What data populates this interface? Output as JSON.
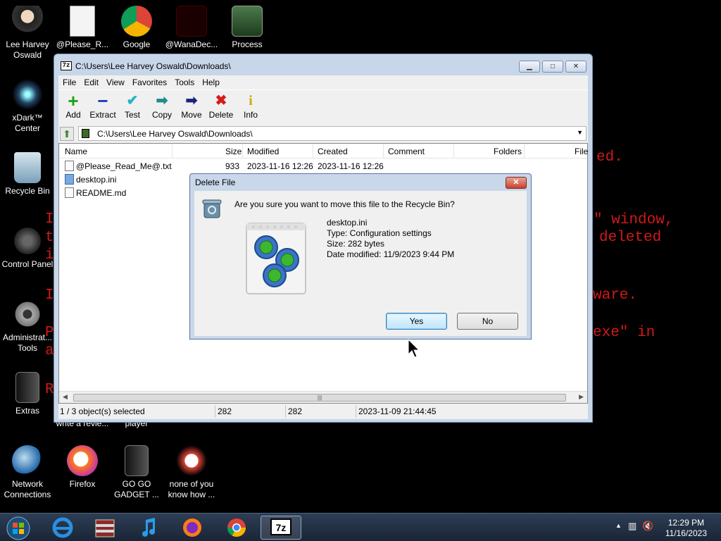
{
  "background_text": [
    {
      "text": "ed."
    },
    {
      "text": "\" window,"
    },
    {
      "text": "deleted"
    },
    {
      "text": "ware."
    },
    {
      "text": "exe\" in"
    },
    {
      "text": "I"
    },
    {
      "text": "t"
    },
    {
      "text": "i"
    },
    {
      "text": "I"
    },
    {
      "text": "P"
    },
    {
      "text": "a"
    },
    {
      "text": "R"
    }
  ],
  "desktop_icons": [
    {
      "label": "Lee Harvey Oswald"
    },
    {
      "label": "@Please_R..."
    },
    {
      "label": "Google"
    },
    {
      "label": "@WanaDec..."
    },
    {
      "label": "Process"
    },
    {
      "label": "xDark™ Center"
    },
    {
      "label": "Recycle Bin"
    },
    {
      "label": "Control Panel"
    },
    {
      "label": "Administrat... Tools"
    },
    {
      "label": "Extras"
    },
    {
      "label": "Network Connections"
    },
    {
      "label": "Firefox"
    },
    {
      "label": "GO GO GADGET ..."
    },
    {
      "label": "none of you know how ..."
    },
    {
      "label": "write a revie..."
    },
    {
      "label": "player"
    }
  ],
  "window": {
    "app_icon": "7z",
    "title": "C:\\Users\\Lee Harvey Oswald\\Downloads\\",
    "menu": [
      "File",
      "Edit",
      "View",
      "Favorites",
      "Tools",
      "Help"
    ],
    "toolbar": [
      {
        "label": "Add",
        "icon": "plus-icon",
        "color": "#1aa31a"
      },
      {
        "label": "Extract",
        "icon": "minus-icon",
        "color": "#1a3bb5"
      },
      {
        "label": "Test",
        "icon": "check-icon",
        "color": "#23b3c8"
      },
      {
        "label": "Copy",
        "icon": "copy-arrow-icon",
        "color": "#1f8a8a"
      },
      {
        "label": "Move",
        "icon": "move-arrow-icon",
        "color": "#16237a"
      },
      {
        "label": "Delete",
        "icon": "delete-x-icon",
        "color": "#d81a1a"
      },
      {
        "label": "Info",
        "icon": "info-icon",
        "color": "#d6a90a"
      }
    ],
    "address": "C:\\Users\\Lee Harvey Oswald\\Downloads\\",
    "columns": [
      "Name",
      "Size",
      "Modified",
      "Created",
      "Comment",
      "Folders",
      "File"
    ],
    "files": [
      {
        "name": "@Please_Read_Me@.txt",
        "size": "933",
        "modified": "2023-11-16 12:26",
        "created": "2023-11-16 12:26"
      },
      {
        "name": "desktop.ini",
        "size": "",
        "modified": "",
        "created": ""
      },
      {
        "name": "README.md",
        "size": "",
        "modified": "",
        "created": ""
      }
    ],
    "status": {
      "selected": "1 / 3 object(s) selected",
      "size1": "282",
      "size2": "282",
      "date": "2023-11-09 21:44:45"
    }
  },
  "dialog": {
    "title": "Delete File",
    "close": "✕",
    "question": "Are you sure you want to move this file to the Recycle Bin?",
    "file_name": "desktop.ini",
    "file_type": "Type: Configuration settings",
    "file_size": "Size: 282 bytes",
    "file_date": "Date modified: 11/9/2023 9:44 PM",
    "yes": "Yes",
    "no": "No"
  },
  "taskbar": {
    "time": "12:29 PM",
    "date": "11/16/2023",
    "apps": [
      "start-orb",
      "internet-explorer",
      "archive-manager",
      "music-player",
      "firefox",
      "chrome",
      "7zip"
    ]
  }
}
